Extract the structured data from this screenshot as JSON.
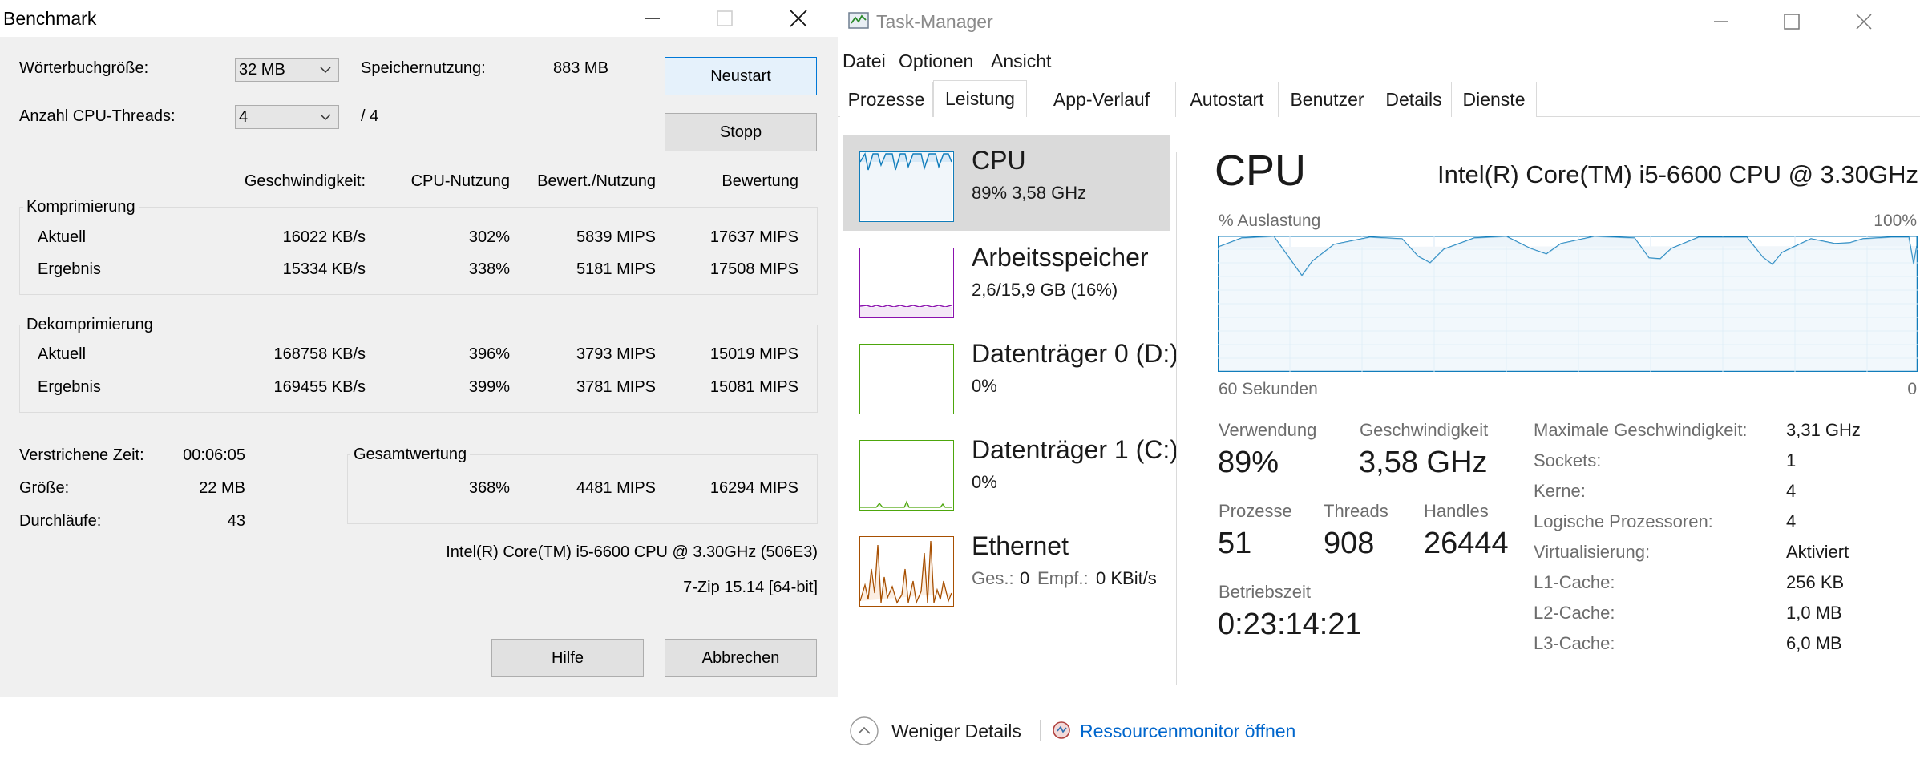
{
  "benchmark": {
    "title": "Benchmark",
    "dict_label": "Wörterbuchgröße:",
    "dict_value": "32 MB",
    "threads_label": "Anzahl CPU-Threads:",
    "threads_value": "4",
    "threads_max": "/ 4",
    "mem_label": "Speichernutzung:",
    "mem_value": "883 MB",
    "restart_button": "Neustart",
    "stop_button": "Stopp",
    "columns": [
      "Geschwindigkeit:",
      "CPU-Nutzung",
      "Bewert./Nutzung",
      "Bewertung"
    ],
    "compress": {
      "title": "Komprimierung",
      "rows": [
        {
          "label": "Aktuell",
          "speed": "16022 KB/s",
          "cpu": "302%",
          "rating_usage": "5839 MIPS",
          "rating": "17637 MIPS"
        },
        {
          "label": "Ergebnis",
          "speed": "15334 KB/s",
          "cpu": "338%",
          "rating_usage": "5181 MIPS",
          "rating": "17508 MIPS"
        }
      ]
    },
    "decompress": {
      "title": "Dekomprimierung",
      "rows": [
        {
          "label": "Aktuell",
          "speed": "168758 KB/s",
          "cpu": "396%",
          "rating_usage": "3793 MIPS",
          "rating": "15019 MIPS"
        },
        {
          "label": "Ergebnis",
          "speed": "169455 KB/s",
          "cpu": "399%",
          "rating_usage": "3781 MIPS",
          "rating": "15081 MIPS"
        }
      ]
    },
    "elapsed_label": "Verstrichene Zeit:",
    "elapsed_value": "00:06:05",
    "size_label": "Größe:",
    "size_value": "22 MB",
    "passes_label": "Durchläufe:",
    "passes_value": "43",
    "total": {
      "title": "Gesamtwertung",
      "cpu": "368%",
      "rating_usage": "4481 MIPS",
      "rating": "16294 MIPS"
    },
    "cpu_info": "Intel(R) Core(TM) i5-6600 CPU @ 3.30GHz (506E3)",
    "version": "7-Zip 15.14 [64-bit]",
    "help_button": "Hilfe",
    "cancel_button": "Abbrechen"
  },
  "taskmgr": {
    "title": "Task-Manager",
    "menu": [
      "Datei",
      "Optionen",
      "Ansicht"
    ],
    "tabs": [
      "Prozesse",
      "Leistung",
      "App-Verlauf",
      "Autostart",
      "Benutzer",
      "Details",
      "Dienste"
    ],
    "active_tab": "Leistung",
    "sidebar": [
      {
        "name": "CPU",
        "sub": "89%  3,58 GHz",
        "color": "#117dbb"
      },
      {
        "name": "Arbeitsspeicher",
        "sub": "2,6/15,9 GB (16%)",
        "color": "#8b12ae"
      },
      {
        "name": "Datenträger 0 (D:)",
        "sub": "0%",
        "color": "#4da60c"
      },
      {
        "name": "Datenträger 1 (C:)",
        "sub": "0%",
        "color": "#4da60c"
      },
      {
        "name": "Ethernet",
        "sub_label1": "Ges.:",
        "sub_val1": "0",
        "sub_label2": "Empf.:",
        "sub_val2": "0 KBit/s",
        "color": "#a74f01"
      }
    ],
    "detail": {
      "heading": "CPU",
      "model": "Intel(R) Core(TM) i5-6600 CPU @ 3.30GHz",
      "graph_label": "% Auslastung",
      "graph_max": "100%",
      "graph_time": "60 Sekunden",
      "graph_min": "0",
      "usage_label": "Verwendung",
      "usage_value": "89%",
      "speed_label": "Geschwindigkeit",
      "speed_value": "3,58 GHz",
      "processes_label": "Prozesse",
      "processes_value": "51",
      "threads_label": "Threads",
      "threads_value": "908",
      "handles_label": "Handles",
      "handles_value": "26444",
      "uptime_label": "Betriebszeit",
      "uptime_value": "0:23:14:21",
      "specs": [
        {
          "k": "Maximale Geschwindigkeit:",
          "v": "3,31 GHz"
        },
        {
          "k": "Sockets:",
          "v": "1"
        },
        {
          "k": "Kerne:",
          "v": "4"
        },
        {
          "k": "Logische Prozessoren:",
          "v": "4"
        },
        {
          "k": "Virtualisierung:",
          "v": "Aktiviert"
        },
        {
          "k": "L1-Cache:",
          "v": "256 KB"
        },
        {
          "k": "L2-Cache:",
          "v": "1,0 MB"
        },
        {
          "k": "L3-Cache:",
          "v": "6,0 MB"
        }
      ]
    },
    "footer": {
      "fewer_details": "Weniger Details",
      "resmon": "Ressourcenmonitor öffnen"
    }
  }
}
